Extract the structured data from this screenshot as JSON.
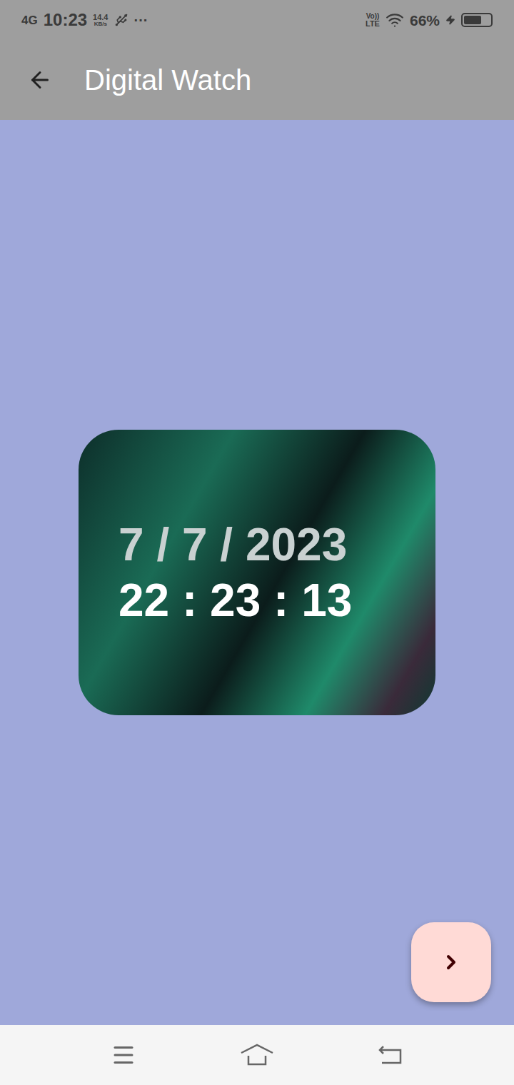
{
  "status_bar": {
    "network": "4G",
    "time": "10:23",
    "speed": "14.4",
    "speed_unit": "KB/s",
    "more": "···",
    "volte": "Vo))",
    "lte": "LTE",
    "battery": "66%",
    "battery_level": 0.66,
    "charging": true
  },
  "app_bar": {
    "title": "Digital Watch"
  },
  "clock": {
    "date": "7 / 7 / 2023",
    "time": "22 : 23 : 13"
  }
}
